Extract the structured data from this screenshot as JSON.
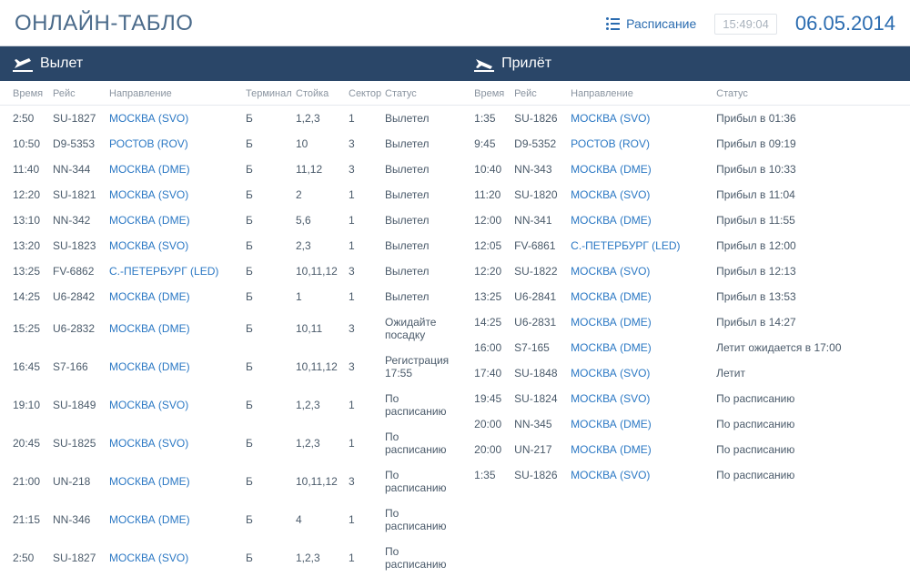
{
  "header": {
    "title": "ОНЛАЙН-ТАБЛО",
    "schedule_label": "Расписание",
    "clock": "15:49:04",
    "date": "06.05.2014"
  },
  "departures": {
    "title": "Вылет",
    "columns": {
      "time": "Время",
      "flight": "Рейс",
      "dest": "Направление",
      "terminal": "Терминал",
      "desk": "Стойка",
      "sector": "Сектор",
      "status": "Статус"
    },
    "rows": [
      {
        "time": "2:50",
        "flight": "SU-1827",
        "dest": "МОСКВА (SVO)",
        "term": "Б",
        "desk": "1,2,3",
        "sector": "1",
        "status": "Вылетел"
      },
      {
        "time": "10:50",
        "flight": "D9-5353",
        "dest": "РОСТОВ (ROV)",
        "term": "Б",
        "desk": "10",
        "sector": "3",
        "status": "Вылетел"
      },
      {
        "time": "11:40",
        "flight": "NN-344",
        "dest": "МОСКВА (DME)",
        "term": "Б",
        "desk": "11,12",
        "sector": "3",
        "status": "Вылетел"
      },
      {
        "time": "12:20",
        "flight": "SU-1821",
        "dest": "МОСКВА (SVO)",
        "term": "Б",
        "desk": "2",
        "sector": "1",
        "status": "Вылетел"
      },
      {
        "time": "13:10",
        "flight": "NN-342",
        "dest": "МОСКВА (DME)",
        "term": "Б",
        "desk": "5,6",
        "sector": "1",
        "status": "Вылетел"
      },
      {
        "time": "13:20",
        "flight": "SU-1823",
        "dest": "МОСКВА (SVO)",
        "term": "Б",
        "desk": "2,3",
        "sector": "1",
        "status": "Вылетел"
      },
      {
        "time": "13:25",
        "flight": "FV-6862",
        "dest": "С.-ПЕТЕРБУРГ (LED)",
        "term": "Б",
        "desk": "10,11,12",
        "sector": "3",
        "status": "Вылетел"
      },
      {
        "time": "14:25",
        "flight": "U6-2842",
        "dest": "МОСКВА (DME)",
        "term": "Б",
        "desk": "1",
        "sector": "1",
        "status": "Вылетел"
      },
      {
        "time": "15:25",
        "flight": "U6-2832",
        "dest": "МОСКВА (DME)",
        "term": "Б",
        "desk": "10,11",
        "sector": "3",
        "status": "Ожидайте посадку"
      },
      {
        "time": "16:45",
        "flight": "S7-166",
        "dest": "МОСКВА (DME)",
        "term": "Б",
        "desk": "10,11,12",
        "sector": "3",
        "status": "Регистрация 17:55"
      },
      {
        "time": "19:10",
        "flight": "SU-1849",
        "dest": "МОСКВА (SVO)",
        "term": "Б",
        "desk": "1,2,3",
        "sector": "1",
        "status": "По расписанию"
      },
      {
        "time": "20:45",
        "flight": "SU-1825",
        "dest": "МОСКВА (SVO)",
        "term": "Б",
        "desk": "1,2,3",
        "sector": "1",
        "status": "По расписанию"
      },
      {
        "time": "21:00",
        "flight": "UN-218",
        "dest": "МОСКВА (DME)",
        "term": "Б",
        "desk": "10,11,12",
        "sector": "3",
        "status": "По расписанию"
      },
      {
        "time": "21:15",
        "flight": "NN-346",
        "dest": "МОСКВА (DME)",
        "term": "Б",
        "desk": "4",
        "sector": "1",
        "status": "По расписанию"
      },
      {
        "time": "2:50",
        "flight": "SU-1827",
        "dest": "МОСКВА (SVO)",
        "term": "Б",
        "desk": "1,2,3",
        "sector": "1",
        "status": "По расписанию"
      }
    ]
  },
  "arrivals": {
    "title": "Прилёт",
    "columns": {
      "time": "Время",
      "flight": "Рейс",
      "dest": "Направление",
      "status": "Статус"
    },
    "rows": [
      {
        "time": "1:35",
        "flight": "SU-1826",
        "dest": "МОСКВА (SVO)",
        "status": "Прибыл в 01:36"
      },
      {
        "time": "9:45",
        "flight": "D9-5352",
        "dest": "РОСТОВ (ROV)",
        "status": "Прибыл в 09:19"
      },
      {
        "time": "10:40",
        "flight": "NN-343",
        "dest": "МОСКВА (DME)",
        "status": "Прибыл в 10:33"
      },
      {
        "time": "11:20",
        "flight": "SU-1820",
        "dest": "МОСКВА (SVO)",
        "status": "Прибыл в 11:04"
      },
      {
        "time": "12:00",
        "flight": "NN-341",
        "dest": "МОСКВА (DME)",
        "status": "Прибыл в 11:55"
      },
      {
        "time": "12:05",
        "flight": "FV-6861",
        "dest": "С.-ПЕТЕРБУРГ (LED)",
        "status": "Прибыл в 12:00"
      },
      {
        "time": "12:20",
        "flight": "SU-1822",
        "dest": "МОСКВА (SVO)",
        "status": "Прибыл в 12:13"
      },
      {
        "time": "13:25",
        "flight": "U6-2841",
        "dest": "МОСКВА (DME)",
        "status": "Прибыл в 13:53"
      },
      {
        "time": "14:25",
        "flight": "U6-2831",
        "dest": "МОСКВА (DME)",
        "status": "Прибыл в 14:27"
      },
      {
        "time": "16:00",
        "flight": "S7-165",
        "dest": "МОСКВА (DME)",
        "status": "Летит ожидается в 17:00"
      },
      {
        "time": "17:40",
        "flight": "SU-1848",
        "dest": "МОСКВА (SVO)",
        "status": "Летит"
      },
      {
        "time": "19:45",
        "flight": "SU-1824",
        "dest": "МОСКВА (SVO)",
        "status": "По расписанию"
      },
      {
        "time": "20:00",
        "flight": "NN-345",
        "dest": "МОСКВА (DME)",
        "status": "По расписанию"
      },
      {
        "time": "20:00",
        "flight": "UN-217",
        "dest": "МОСКВА (DME)",
        "status": "По расписанию"
      },
      {
        "time": "1:35",
        "flight": "SU-1826",
        "dest": "МОСКВА (SVO)",
        "status": "По расписанию"
      }
    ]
  }
}
